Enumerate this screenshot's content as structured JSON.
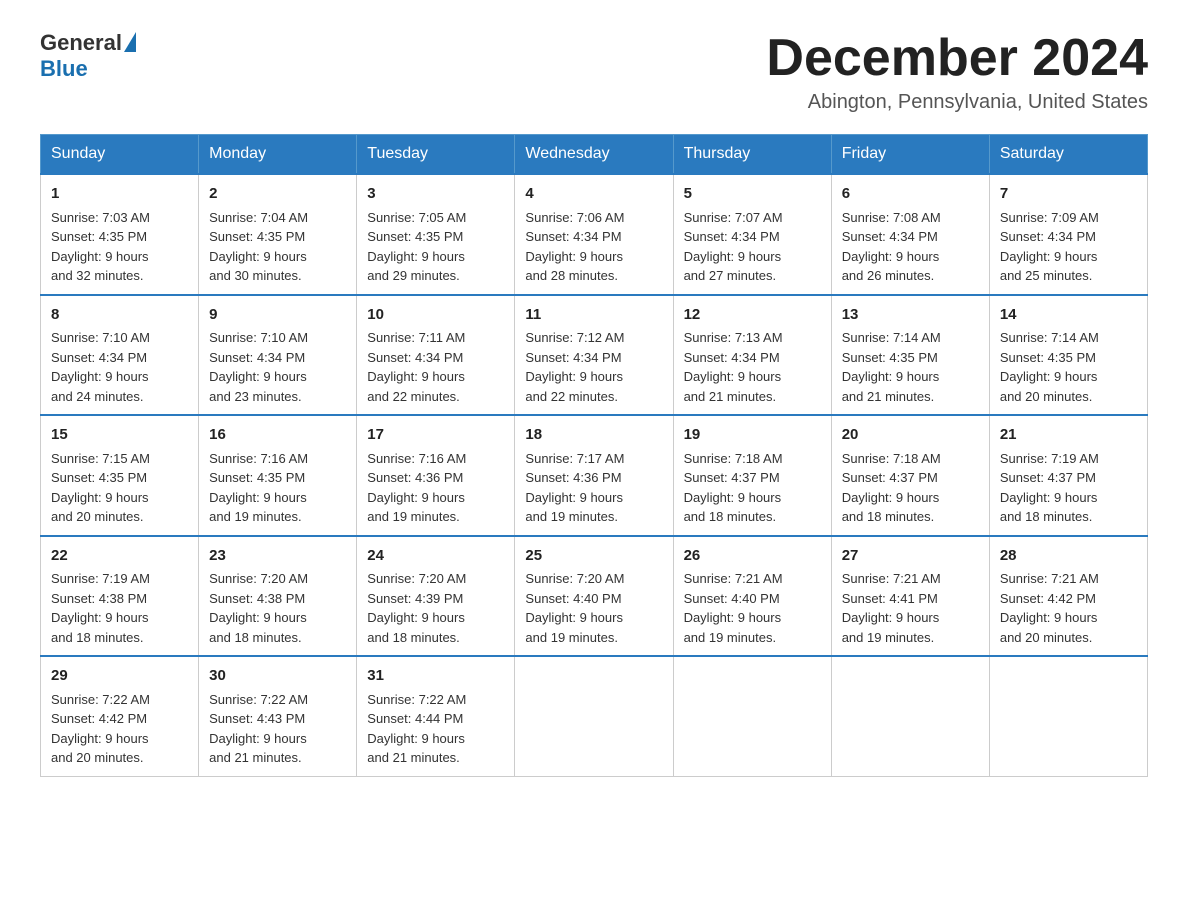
{
  "header": {
    "logo_general": "General",
    "logo_blue": "Blue",
    "month_title": "December 2024",
    "location": "Abington, Pennsylvania, United States"
  },
  "days_of_week": [
    "Sunday",
    "Monday",
    "Tuesday",
    "Wednesday",
    "Thursday",
    "Friday",
    "Saturday"
  ],
  "weeks": [
    [
      {
        "day": "1",
        "sunrise": "7:03 AM",
        "sunset": "4:35 PM",
        "daylight": "9 hours and 32 minutes."
      },
      {
        "day": "2",
        "sunrise": "7:04 AM",
        "sunset": "4:35 PM",
        "daylight": "9 hours and 30 minutes."
      },
      {
        "day": "3",
        "sunrise": "7:05 AM",
        "sunset": "4:35 PM",
        "daylight": "9 hours and 29 minutes."
      },
      {
        "day": "4",
        "sunrise": "7:06 AM",
        "sunset": "4:34 PM",
        "daylight": "9 hours and 28 minutes."
      },
      {
        "day": "5",
        "sunrise": "7:07 AM",
        "sunset": "4:34 PM",
        "daylight": "9 hours and 27 minutes."
      },
      {
        "day": "6",
        "sunrise": "7:08 AM",
        "sunset": "4:34 PM",
        "daylight": "9 hours and 26 minutes."
      },
      {
        "day": "7",
        "sunrise": "7:09 AM",
        "sunset": "4:34 PM",
        "daylight": "9 hours and 25 minutes."
      }
    ],
    [
      {
        "day": "8",
        "sunrise": "7:10 AM",
        "sunset": "4:34 PM",
        "daylight": "9 hours and 24 minutes."
      },
      {
        "day": "9",
        "sunrise": "7:10 AM",
        "sunset": "4:34 PM",
        "daylight": "9 hours and 23 minutes."
      },
      {
        "day": "10",
        "sunrise": "7:11 AM",
        "sunset": "4:34 PM",
        "daylight": "9 hours and 22 minutes."
      },
      {
        "day": "11",
        "sunrise": "7:12 AM",
        "sunset": "4:34 PM",
        "daylight": "9 hours and 22 minutes."
      },
      {
        "day": "12",
        "sunrise": "7:13 AM",
        "sunset": "4:34 PM",
        "daylight": "9 hours and 21 minutes."
      },
      {
        "day": "13",
        "sunrise": "7:14 AM",
        "sunset": "4:35 PM",
        "daylight": "9 hours and 21 minutes."
      },
      {
        "day": "14",
        "sunrise": "7:14 AM",
        "sunset": "4:35 PM",
        "daylight": "9 hours and 20 minutes."
      }
    ],
    [
      {
        "day": "15",
        "sunrise": "7:15 AM",
        "sunset": "4:35 PM",
        "daylight": "9 hours and 20 minutes."
      },
      {
        "day": "16",
        "sunrise": "7:16 AM",
        "sunset": "4:35 PM",
        "daylight": "9 hours and 19 minutes."
      },
      {
        "day": "17",
        "sunrise": "7:16 AM",
        "sunset": "4:36 PM",
        "daylight": "9 hours and 19 minutes."
      },
      {
        "day": "18",
        "sunrise": "7:17 AM",
        "sunset": "4:36 PM",
        "daylight": "9 hours and 19 minutes."
      },
      {
        "day": "19",
        "sunrise": "7:18 AM",
        "sunset": "4:37 PM",
        "daylight": "9 hours and 18 minutes."
      },
      {
        "day": "20",
        "sunrise": "7:18 AM",
        "sunset": "4:37 PM",
        "daylight": "9 hours and 18 minutes."
      },
      {
        "day": "21",
        "sunrise": "7:19 AM",
        "sunset": "4:37 PM",
        "daylight": "9 hours and 18 minutes."
      }
    ],
    [
      {
        "day": "22",
        "sunrise": "7:19 AM",
        "sunset": "4:38 PM",
        "daylight": "9 hours and 18 minutes."
      },
      {
        "day": "23",
        "sunrise": "7:20 AM",
        "sunset": "4:38 PM",
        "daylight": "9 hours and 18 minutes."
      },
      {
        "day": "24",
        "sunrise": "7:20 AM",
        "sunset": "4:39 PM",
        "daylight": "9 hours and 18 minutes."
      },
      {
        "day": "25",
        "sunrise": "7:20 AM",
        "sunset": "4:40 PM",
        "daylight": "9 hours and 19 minutes."
      },
      {
        "day": "26",
        "sunrise": "7:21 AM",
        "sunset": "4:40 PM",
        "daylight": "9 hours and 19 minutes."
      },
      {
        "day": "27",
        "sunrise": "7:21 AM",
        "sunset": "4:41 PM",
        "daylight": "9 hours and 19 minutes."
      },
      {
        "day": "28",
        "sunrise": "7:21 AM",
        "sunset": "4:42 PM",
        "daylight": "9 hours and 20 minutes."
      }
    ],
    [
      {
        "day": "29",
        "sunrise": "7:22 AM",
        "sunset": "4:42 PM",
        "daylight": "9 hours and 20 minutes."
      },
      {
        "day": "30",
        "sunrise": "7:22 AM",
        "sunset": "4:43 PM",
        "daylight": "9 hours and 21 minutes."
      },
      {
        "day": "31",
        "sunrise": "7:22 AM",
        "sunset": "4:44 PM",
        "daylight": "9 hours and 21 minutes."
      },
      null,
      null,
      null,
      null
    ]
  ]
}
